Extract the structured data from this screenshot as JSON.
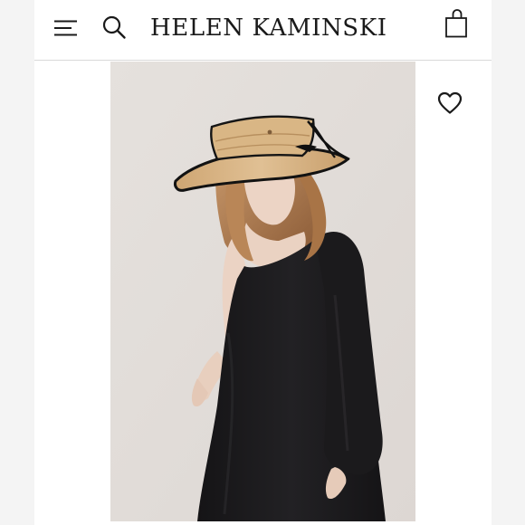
{
  "brand": {
    "name": "HELEN KAMINSKI"
  },
  "icons": {
    "menu": "menu-icon",
    "search": "search-icon",
    "bag": "shopping-bag-icon",
    "wishlist": "heart-icon"
  },
  "colors": {
    "background": "#f4f4f4",
    "page": "#ffffff",
    "text": "#1a1a1a",
    "divider": "#d9d9d9",
    "photo_backdrop": "#e3dedb",
    "dress": "#1c1b1d",
    "straw": "#d6b283",
    "hair": "#b07d53",
    "skin": "#ead2c2"
  }
}
